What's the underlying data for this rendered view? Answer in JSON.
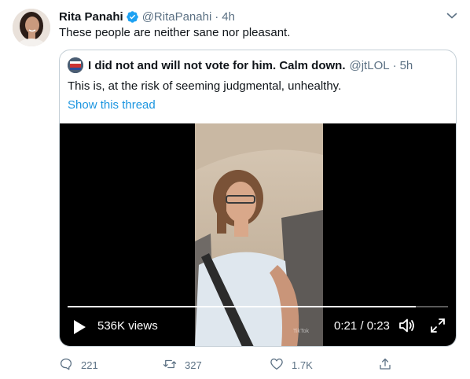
{
  "tweet": {
    "author_name": "Rita Panahi",
    "handle": "@RitaPanahi",
    "separator": "·",
    "time": "4h",
    "text": "These people are neither sane nor pleasant."
  },
  "quoted": {
    "author_name": "I did not and will not vote for him. Calm down.",
    "handle": "@jtLOL",
    "separator": "·",
    "time": "5h",
    "text": "This is, at the risk of seeming judgmental, unhealthy.",
    "thread_link": "Show this thread",
    "video": {
      "views": "536K views",
      "timecode": "0:21 / 0:23",
      "progress": 0.915,
      "watermark": "TikTok"
    }
  },
  "actions": {
    "reply_count": "221",
    "retweet_count": "327",
    "like_count": "1.7K"
  },
  "colors": {
    "accent": "#1b95e0",
    "verified": "#1da1f2",
    "muted": "#5b7083"
  },
  "icons": [
    "verified-icon",
    "caret-down-icon",
    "play-icon",
    "volume-icon",
    "fullscreen-icon",
    "reply-icon",
    "retweet-icon",
    "like-icon",
    "share-icon"
  ]
}
